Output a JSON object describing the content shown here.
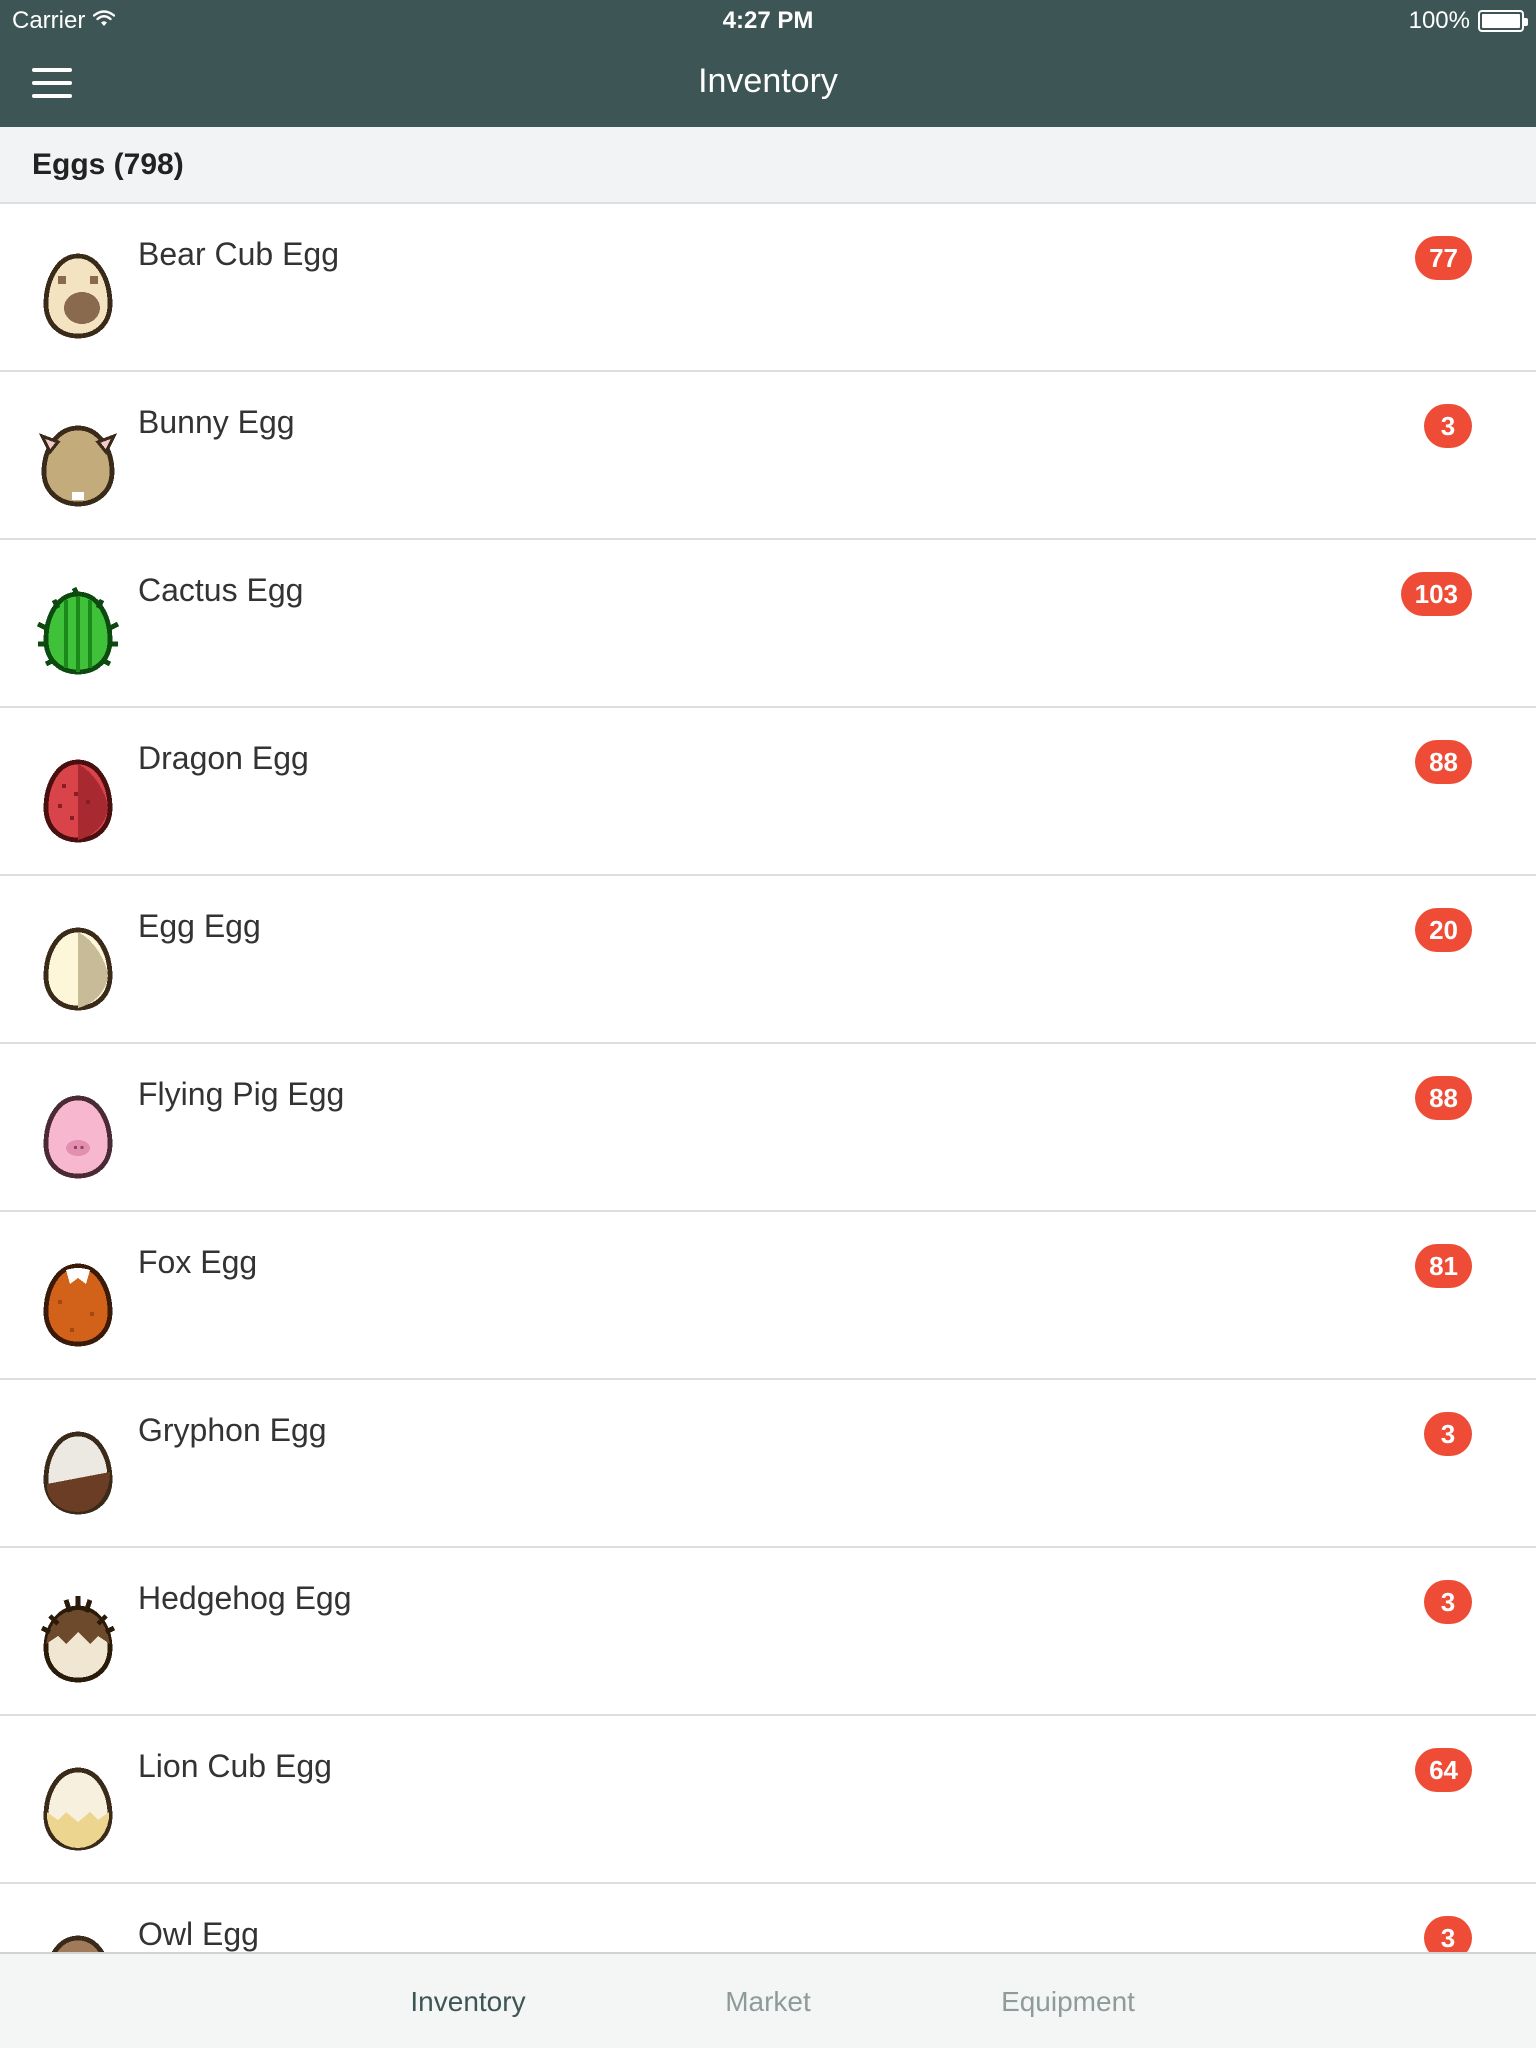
{
  "status": {
    "carrier": "Carrier",
    "time": "4:27 PM",
    "battery": "100%"
  },
  "nav": {
    "title": "Inventory"
  },
  "section": {
    "header": "Eggs (798)"
  },
  "items": [
    {
      "name": "Bear Cub Egg",
      "count": "77",
      "icon": "bear-cub-egg-icon"
    },
    {
      "name": "Bunny Egg",
      "count": "3",
      "icon": "bunny-egg-icon"
    },
    {
      "name": "Cactus Egg",
      "count": "103",
      "icon": "cactus-egg-icon"
    },
    {
      "name": "Dragon Egg",
      "count": "88",
      "icon": "dragon-egg-icon"
    },
    {
      "name": "Egg Egg",
      "count": "20",
      "icon": "egg-egg-icon"
    },
    {
      "name": "Flying Pig Egg",
      "count": "88",
      "icon": "flying-pig-egg-icon"
    },
    {
      "name": "Fox Egg",
      "count": "81",
      "icon": "fox-egg-icon"
    },
    {
      "name": "Gryphon Egg",
      "count": "3",
      "icon": "gryphon-egg-icon"
    },
    {
      "name": "Hedgehog Egg",
      "count": "3",
      "icon": "hedgehog-egg-icon"
    },
    {
      "name": "Lion Cub Egg",
      "count": "64",
      "icon": "lion-cub-egg-icon"
    },
    {
      "name": "Owl Egg",
      "count": "3",
      "icon": "owl-egg-icon"
    }
  ],
  "tabs": [
    {
      "label": "Inventory",
      "active": true
    },
    {
      "label": "Market",
      "active": false
    },
    {
      "label": "Equipment",
      "active": false
    }
  ],
  "colors": {
    "nav_bg": "#3d5554",
    "badge": "#ee4c37",
    "section_bg": "#f1f3f4",
    "tab_active": "#3d5554",
    "tab_inactive": "#8e9b9a"
  }
}
